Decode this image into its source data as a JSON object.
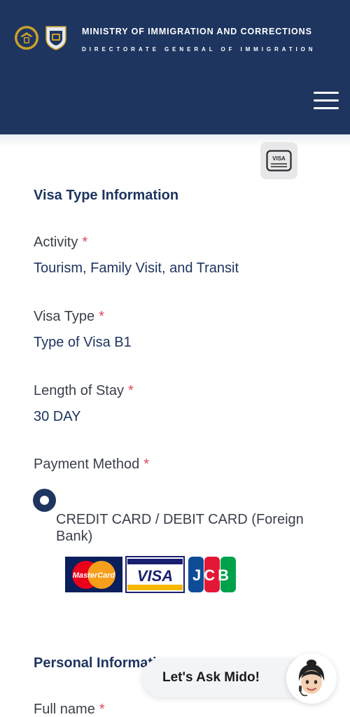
{
  "header": {
    "title": "MINISTRY OF IMMIGRATION AND CORRECTIONS",
    "subtitle": "DIRECTORATE GENERAL OF IMMIGRATION"
  },
  "visa_type_section": {
    "title": "Visa Type Information",
    "activity": {
      "label": "Activity",
      "required": "*",
      "value": "Tourism, Family Visit, and Transit"
    },
    "visa_type": {
      "label": "Visa Type",
      "required": "*",
      "value": "Type of Visa B1"
    },
    "length_of_stay": {
      "label": "Length of Stay",
      "required": "*",
      "value": "30 DAY"
    },
    "payment_method": {
      "label": "Payment Method",
      "required": "*",
      "option_label": "CREDIT CARD / DEBIT CARD (Foreign Bank)",
      "selected": true,
      "card_brands": [
        "MasterCard",
        "VISA",
        "JCB"
      ]
    }
  },
  "personal_section": {
    "title": "Personal Information",
    "full_name": {
      "label": "Full name",
      "required": "*"
    }
  },
  "chat": {
    "label": "Let's Ask Mido!"
  },
  "icons": {
    "menu": "hamburger-menu-icon",
    "visa_badge": "visa-card-icon",
    "logo_left": "garuda-emblem-icon",
    "logo_right": "immigration-logo-icon"
  },
  "colors": {
    "header_bg": "#1e3560",
    "required": "#e0455b",
    "heading": "#1e3560"
  }
}
